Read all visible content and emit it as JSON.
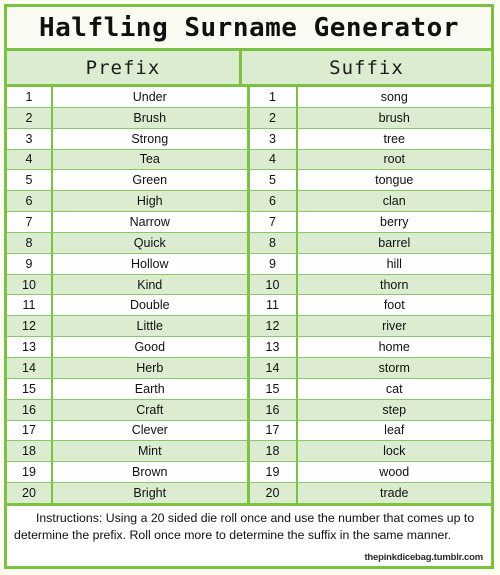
{
  "title": "Halfling Surname Generator",
  "columns": {
    "prefix_header": "Prefix",
    "suffix_header": "Suffix"
  },
  "rows": [
    {
      "n": "1",
      "prefix": "Under",
      "suffix_n": "1",
      "suffix": "song"
    },
    {
      "n": "2",
      "prefix": "Brush",
      "suffix_n": "2",
      "suffix": "brush"
    },
    {
      "n": "3",
      "prefix": "Strong",
      "suffix_n": "3",
      "suffix": "tree"
    },
    {
      "n": "4",
      "prefix": "Tea",
      "suffix_n": "4",
      "suffix": "root"
    },
    {
      "n": "5",
      "prefix": "Green",
      "suffix_n": "5",
      "suffix": "tongue"
    },
    {
      "n": "6",
      "prefix": "High",
      "suffix_n": "6",
      "suffix": "clan"
    },
    {
      "n": "7",
      "prefix": "Narrow",
      "suffix_n": "7",
      "suffix": "berry"
    },
    {
      "n": "8",
      "prefix": "Quick",
      "suffix_n": "8",
      "suffix": "barrel"
    },
    {
      "n": "9",
      "prefix": "Hollow",
      "suffix_n": "9",
      "suffix": "hill"
    },
    {
      "n": "10",
      "prefix": "Kind",
      "suffix_n": "10",
      "suffix": "thorn"
    },
    {
      "n": "11",
      "prefix": "Double",
      "suffix_n": "11",
      "suffix": "foot"
    },
    {
      "n": "12",
      "prefix": "Little",
      "suffix_n": "12",
      "suffix": "river"
    },
    {
      "n": "13",
      "prefix": "Good",
      "suffix_n": "13",
      "suffix": "home"
    },
    {
      "n": "14",
      "prefix": "Herb",
      "suffix_n": "14",
      "suffix": "storm"
    },
    {
      "n": "15",
      "prefix": "Earth",
      "suffix_n": "15",
      "suffix": "cat"
    },
    {
      "n": "16",
      "prefix": "Craft",
      "suffix_n": "16",
      "suffix": "step"
    },
    {
      "n": "17",
      "prefix": "Clever",
      "suffix_n": "17",
      "suffix": "leaf"
    },
    {
      "n": "18",
      "prefix": "Mint",
      "suffix_n": "18",
      "suffix": "lock"
    },
    {
      "n": "19",
      "prefix": "Brown",
      "suffix_n": "19",
      "suffix": "wood"
    },
    {
      "n": "20",
      "prefix": "Bright",
      "suffix_n": "20",
      "suffix": "trade"
    }
  ],
  "footer": {
    "instructions": "Instructions:  Using a 20 sided die roll once and use the number that comes up to determine the prefix. Roll once more to determine the suffix in the same manner.",
    "credit": "thepinkdicebag.tumblr.com"
  },
  "colors": {
    "border_green": "#7cc242",
    "stripe_green": "#dcecd0",
    "page_cream": "#fdfdf2",
    "text": "#101010"
  }
}
